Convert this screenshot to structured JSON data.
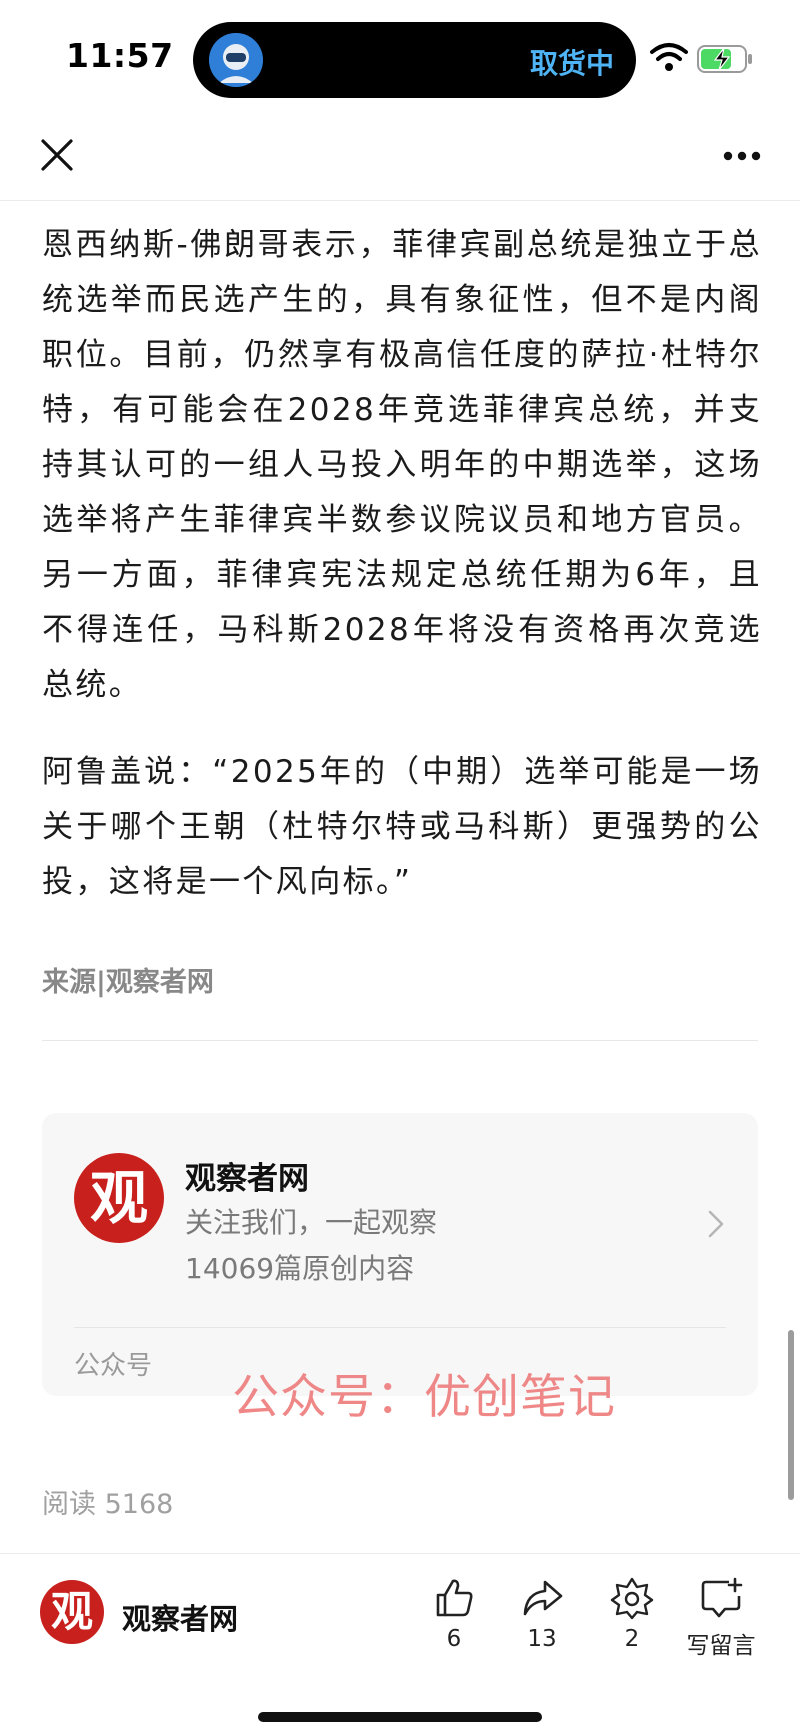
{
  "status_bar": {
    "time": "11:57",
    "activity_text": "取货中"
  },
  "article": {
    "paragraphs": [
      "恩西纳斯-佛朗哥表示，菲律宾副总统是独立于总统选举而民选产生的，具有象征性，但不是内阁职位。目前，仍然享有极高信任度的萨拉·杜特尔特，有可能会在2028年竞选菲律宾总统，并支持其认可的一组人马投入明年的中期选举，这场选举将产生菲律宾半数参议院议员和地方官员。另一方面，菲律宾宪法规定总统任期为6年，且不得连任，马科斯2028年将没有资格再次竞选总统。",
      "阿鲁盖说：“2025年的（中期）选举可能是一场关于哪个王朝（杜特尔特或马科斯）更强势的公投，这将是一个风向标。”"
    ],
    "source": "来源|观察者网"
  },
  "account_card": {
    "logo_text": "观",
    "name": "观察者网",
    "description": "关注我们，一起观察",
    "original_count": "14069篇原创内容",
    "type_label": "公众号"
  },
  "watermark": "公众号：优创笔记",
  "read_count": "阅读 5168",
  "toolbar": {
    "account_name": "观察者网",
    "like_count": "6",
    "share_count": "13",
    "favorite_count": "2",
    "comment_label": "写留言"
  },
  "colors": {
    "brand_red": "#c8201d",
    "island_text": "#4fb4f5",
    "watermark": "#ee7b7b"
  }
}
